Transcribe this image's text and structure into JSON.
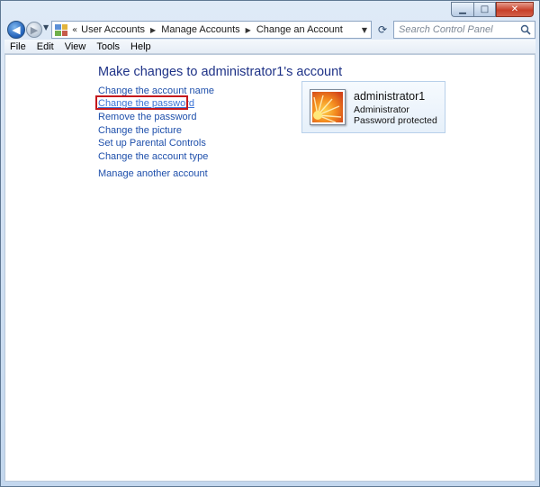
{
  "nav": {
    "history_chevron": "«",
    "breadcrumbs": [
      "User Accounts",
      "Manage Accounts",
      "Change an Account"
    ],
    "search_placeholder": "Search Control Panel"
  },
  "menu": [
    "File",
    "Edit",
    "View",
    "Tools",
    "Help"
  ],
  "page": {
    "title": "Make changes to administrator1's account",
    "tasks": [
      "Change the account name",
      "Change the password",
      "Remove the password",
      "Change the picture",
      "Set up Parental Controls",
      "Change the account type"
    ],
    "other_task": "Manage another account"
  },
  "account": {
    "name": "administrator1",
    "type": "Administrator",
    "status": "Password protected"
  },
  "colors": {
    "link": "#1e4fab",
    "link_hover": "#3a73d6",
    "title": "#1e3287",
    "highlight_box": "#c4161c"
  }
}
